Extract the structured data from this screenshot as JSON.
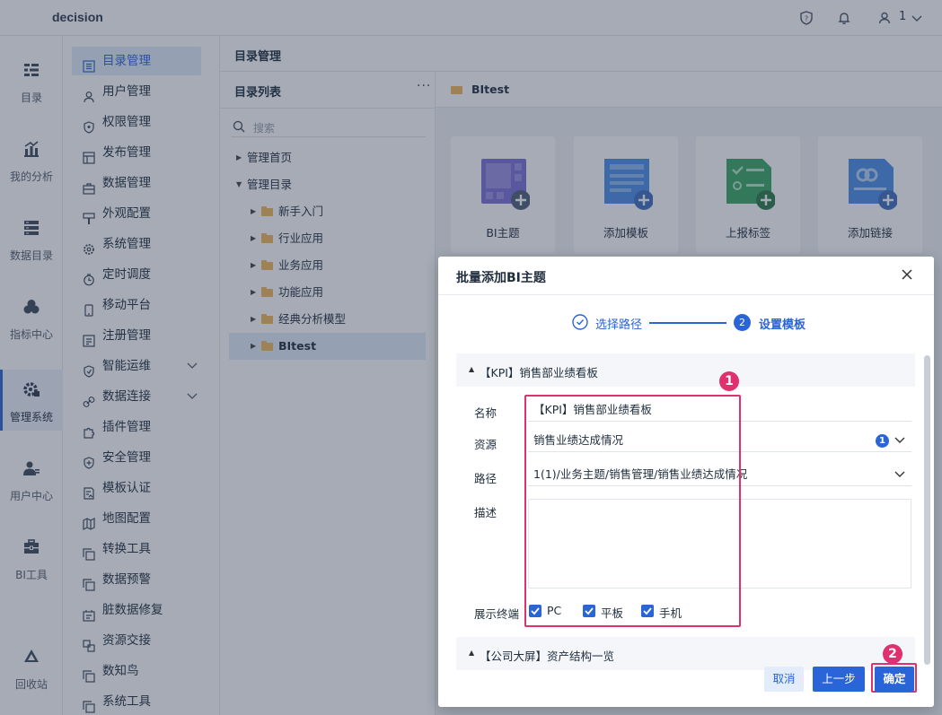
{
  "app": {
    "brand": "decision",
    "user_count": "1"
  },
  "left_nav": [
    {
      "label": "目录",
      "icon": "catalog-icon",
      "active": false
    },
    {
      "label": "我的分析",
      "icon": "analysis-icon",
      "active": false
    },
    {
      "label": "数据目录",
      "icon": "data-catalog-icon",
      "active": false
    },
    {
      "label": "指标中心",
      "icon": "metrics-icon",
      "active": false
    },
    {
      "label": "管理系统",
      "icon": "gear-icon",
      "active": true
    },
    {
      "label": "用户中心",
      "icon": "user-center-icon",
      "active": false
    },
    {
      "label": "BI工具",
      "icon": "toolbox-icon",
      "active": false
    },
    {
      "label": "回收站",
      "icon": "recycle-icon",
      "active": false
    }
  ],
  "submenu": [
    {
      "label": "目录管理",
      "active": true
    },
    {
      "label": "用户管理"
    },
    {
      "label": "权限管理"
    },
    {
      "label": "发布管理"
    },
    {
      "label": "数据管理"
    },
    {
      "label": "外观配置"
    },
    {
      "label": "系统管理"
    },
    {
      "label": "定时调度"
    },
    {
      "label": "移动平台"
    },
    {
      "label": "注册管理"
    },
    {
      "label": "智能运维",
      "expandable": true
    },
    {
      "label": "数据连接",
      "expandable": true
    },
    {
      "label": "插件管理"
    },
    {
      "label": "安全管理"
    },
    {
      "label": "模板认证"
    },
    {
      "label": "地图配置"
    },
    {
      "label": "转换工具"
    },
    {
      "label": "数据预警"
    },
    {
      "label": "脏数据修复"
    },
    {
      "label": "资源交接"
    },
    {
      "label": "数知鸟"
    },
    {
      "label": "系统工具"
    }
  ],
  "main": {
    "title": "目录管理"
  },
  "tree": {
    "title": "目录列表",
    "more": "···",
    "search_placeholder": "搜索",
    "nodes": [
      {
        "label": "管理首页",
        "level": 0,
        "folder": false,
        "expanded": false
      },
      {
        "label": "管理目录",
        "level": 0,
        "folder": false,
        "expanded": true
      },
      {
        "label": "新手入门",
        "level": 1,
        "folder": true
      },
      {
        "label": "行业应用",
        "level": 1,
        "folder": true
      },
      {
        "label": "业务应用",
        "level": 1,
        "folder": true
      },
      {
        "label": "功能应用",
        "level": 1,
        "folder": true
      },
      {
        "label": "经典分析模型",
        "level": 1,
        "folder": true
      },
      {
        "label": "BItest",
        "level": 1,
        "folder": true,
        "selected": true
      }
    ]
  },
  "content": {
    "folder_title": "BItest",
    "cards": [
      {
        "label": "BI主题",
        "icon": "bi-theme-icon",
        "color": "#7b6fd6"
      },
      {
        "label": "添加模板",
        "icon": "add-template-icon",
        "color": "#4a8ee8"
      },
      {
        "label": "上报标签",
        "icon": "report-tag-icon",
        "color": "#3aa864"
      },
      {
        "label": "添加链接",
        "icon": "add-link-icon",
        "color": "#4a8ee8"
      }
    ]
  },
  "dialog": {
    "title": "批量添加BI主题",
    "steps": [
      {
        "label": "选择路径",
        "done": true
      },
      {
        "label": "设置模板",
        "number": "2",
        "current": true
      }
    ],
    "groups": [
      {
        "title": "【KPI】销售部业绩看板",
        "fields": {
          "name_label": "名称",
          "name_value": "【KPI】销售部业绩看板",
          "resource_label": "资源",
          "resource_value": "销售业绩达成情况",
          "resource_badge": "1",
          "path_label": "路径",
          "path_value": "1(1)/业务主题/销售管理/销售业绩达成情况",
          "desc_label": "描述",
          "desc_value": "",
          "terminal_label": "展示终端",
          "terminals": [
            {
              "label": "PC",
              "checked": true
            },
            {
              "label": "平板",
              "checked": true
            },
            {
              "label": "手机",
              "checked": true
            }
          ]
        }
      },
      {
        "title": "【公司大屏】资产结构一览"
      }
    ],
    "buttons": {
      "cancel": "取消",
      "prev": "上一步",
      "ok": "确定"
    }
  },
  "annotations": {
    "marker1": "1",
    "marker2": "2",
    "color": "#e0306e"
  },
  "colors": {
    "accent": "#2965d8",
    "folder": "#f2b85c",
    "highlight": "#e0306e"
  }
}
